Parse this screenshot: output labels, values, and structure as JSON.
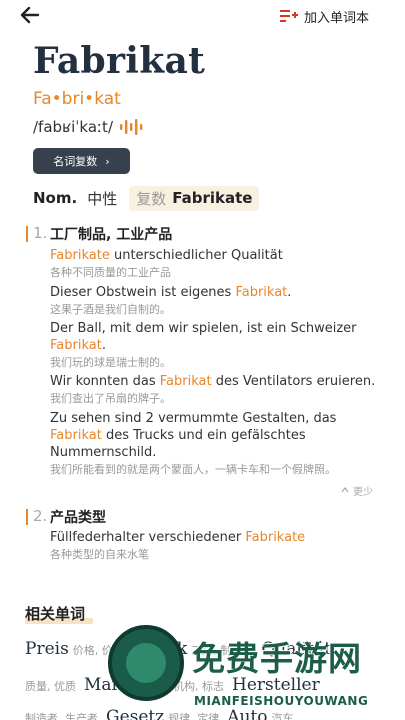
{
  "topbar": {
    "add_label": "加入单词本"
  },
  "entry": {
    "headword": "Fabrikat",
    "syllables": "Fa•bri•kat",
    "ipa": "/fabʁiˈkaːt/",
    "plural_button": "名词复数",
    "plural_button_chev": "›",
    "grammar": {
      "pos": "Nom.",
      "gender": "中性",
      "plural_label": "复数",
      "plural_form": "Fabrikate"
    }
  },
  "senses": [
    {
      "num": "1.",
      "title": "工厂制品, 工业产品",
      "examples": [
        {
          "before": "",
          "hl": "Fabrikate",
          "after": " unterschiedlicher Qualität",
          "zh": "各种不同质量的工业产品"
        },
        {
          "before": "Dieser Obstwein ist eigenes ",
          "hl": "Fabrikat",
          "after": ".",
          "zh": "这果子酒是我们自制的。"
        },
        {
          "before": "Der Ball, mit dem wir spielen, ist ein Schweizer ",
          "hl": "Fabrikat",
          "after": ".",
          "zh": "我们玩的球是瑞士制的。"
        },
        {
          "before": "Wir konnten das ",
          "hl": "Fabrikat",
          "after": " des Ventilators eruieren.",
          "zh": "我们查出了吊扇的牌子。"
        },
        {
          "before": "Zu sehen sind 2 vermummte Gestalten, das ",
          "hl": "Fabrikat",
          "after": " des Trucks und ein gefälschtes Nummernschild.",
          "zh": "我们所能看到的就是两个蒙面人，一辆卡车和一个假牌照。"
        }
      ]
    },
    {
      "num": "2.",
      "title": "产品类型",
      "examples": [
        {
          "before": "Füllfederhalter verschiedener ",
          "hl": "Fabrikate",
          "after": "",
          "zh": "各种类型的自来水笔"
        }
      ]
    }
  ],
  "less_label": "更少",
  "related": {
    "title": "相关单词",
    "items": [
      {
        "word": "Preis",
        "meaning": "价格, 价钱"
      },
      {
        "word": "Fabrik",
        "meaning": "工厂, 制造厂"
      },
      {
        "word": "Qualität",
        "meaning": "质量, 优质"
      },
      {
        "word": "Marke",
        "meaning": "商标, 机构, 标志"
      },
      {
        "word": "Hersteller",
        "meaning": "制造者, 生产者"
      },
      {
        "word": "Gesetz",
        "meaning": "规律, 定律"
      },
      {
        "word": "Auto",
        "meaning": "汽车"
      }
    ]
  },
  "watermark": {
    "text": "免费手游网",
    "sub": "MIANFEISHOUYOUWANG"
  }
}
